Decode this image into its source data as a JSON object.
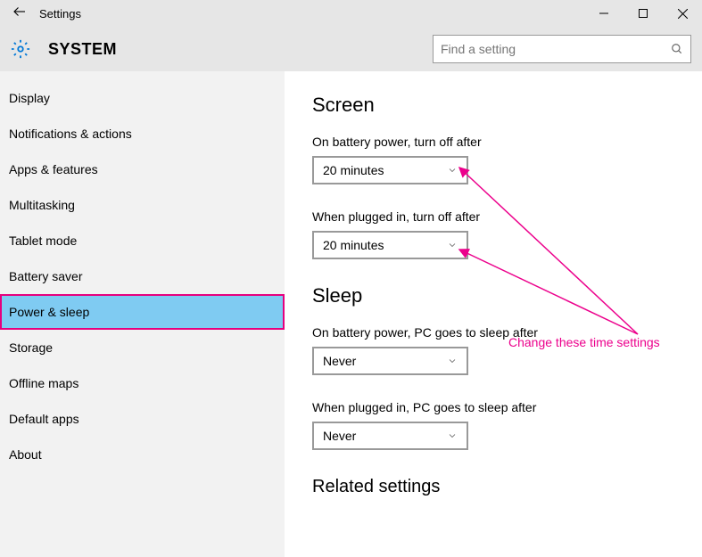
{
  "titlebar": {
    "title": "Settings"
  },
  "header": {
    "system": "SYSTEM",
    "search_placeholder": "Find a setting"
  },
  "sidebar": {
    "items": [
      {
        "label": "Display"
      },
      {
        "label": "Notifications & actions"
      },
      {
        "label": "Apps & features"
      },
      {
        "label": "Multitasking"
      },
      {
        "label": "Tablet mode"
      },
      {
        "label": "Battery saver"
      },
      {
        "label": "Power & sleep"
      },
      {
        "label": "Storage"
      },
      {
        "label": "Offline maps"
      },
      {
        "label": "Default apps"
      },
      {
        "label": "About"
      }
    ]
  },
  "main": {
    "screen": {
      "heading": "Screen",
      "battery_label": "On battery power, turn off after",
      "battery_value": "20 minutes",
      "plugged_label": "When plugged in, turn off after",
      "plugged_value": "20 minutes"
    },
    "sleep": {
      "heading": "Sleep",
      "battery_label": "On battery power, PC goes to sleep after",
      "battery_value": "Never",
      "plugged_label": "When plugged in, PC goes to sleep after",
      "plugged_value": "Never"
    },
    "related_heading": "Related settings"
  },
  "annotation": {
    "text": "Change these time settings"
  }
}
